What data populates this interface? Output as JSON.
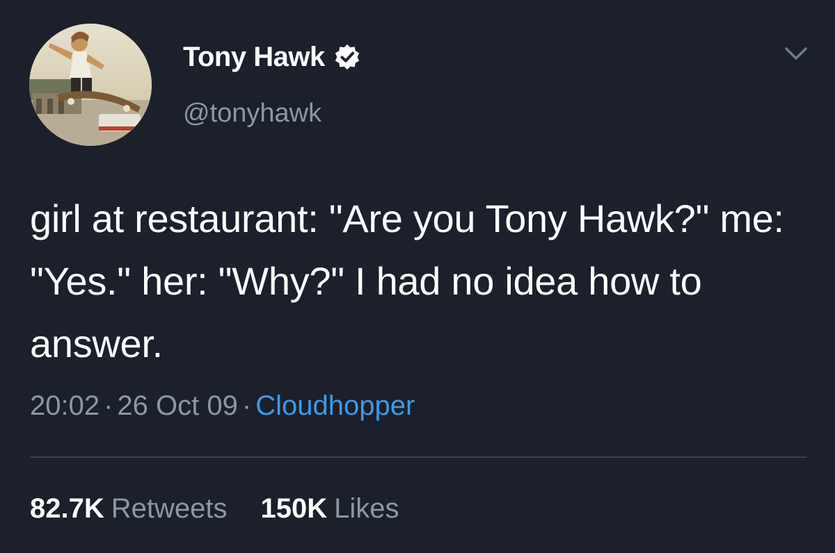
{
  "author": {
    "display_name": "Tony Hawk",
    "handle": "@tonyhawk",
    "verified": true,
    "avatar_icon": "avatar-photo-skateboarder"
  },
  "tweet": {
    "text": "girl at restaurant: \"Are you Tony Hawk?\" me: \"Yes.\" her: \"Why?\" I had no idea how to answer.",
    "time": "20:02",
    "date": "26 Oct 09",
    "separator": "·",
    "source": "Cloudhopper"
  },
  "stats": {
    "retweets_count": "82.7K",
    "retweets_label": "Retweets",
    "likes_count": "150K",
    "likes_label": "Likes"
  },
  "colors": {
    "background": "#1b202a",
    "text_primary": "#ffffff",
    "text_secondary": "#8b98a5",
    "link": "#3c9ae8",
    "divider": "#38414d"
  },
  "icons": {
    "verified": "verified-badge-icon",
    "menu": "chevron-down-icon"
  }
}
